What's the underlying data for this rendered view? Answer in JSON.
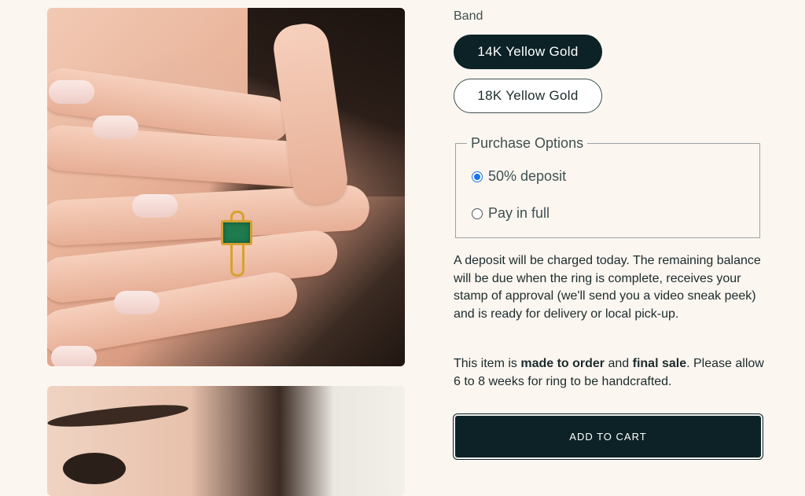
{
  "product": {
    "band_label": "Band",
    "variants": [
      {
        "label": "14K Yellow Gold",
        "selected": true
      },
      {
        "label": "18K Yellow Gold",
        "selected": false
      }
    ],
    "purchase_options": {
      "legend": "Purchase Options",
      "options": [
        {
          "label": "50% deposit",
          "checked": true
        },
        {
          "label": "Pay in full",
          "checked": false
        }
      ]
    },
    "deposit_note": "A deposit will be charged today. The remaining balance will be due when the ring is complete, receives your stamp of approval (we'll send you a video sneak peek) and is ready for delivery or local pick-up.",
    "order_note": {
      "prefix": "This item is ",
      "bold1": "made to order",
      "middle": " and ",
      "bold2": "final sale",
      "suffix": ". Please allow 6 to 8 weeks for ring to be handcrafted."
    },
    "add_to_cart_label": "ADD TO CART"
  },
  "colors": {
    "background": "#fcf6f1",
    "primary_dark": "#0c2226",
    "muted_text": "#3e5150",
    "radio_accent": "#1a73e8",
    "gem": "#1f7a4e",
    "gold": "#d7a22c"
  }
}
